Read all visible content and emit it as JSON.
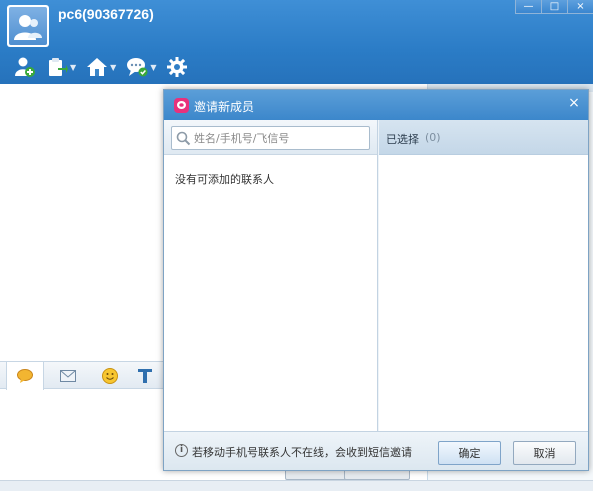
{
  "user": {
    "name": "pc6(90367726)"
  },
  "window_controls": [
    "—",
    "□",
    "×"
  ],
  "toolbar": {
    "items": [
      "add-contact-icon",
      "clipboard-icon",
      "home-icon",
      "chat-status-icon",
      "gear-icon"
    ]
  },
  "dialog": {
    "title": "邀请新成员",
    "close": "×",
    "search_placeholder": "姓名/手机号/飞信号",
    "empty_contacts": "没有可添加的联系人",
    "selected_label": "已选择",
    "selected_count": "(0)",
    "footer_note": "若移动手机号联系人不在线，会收到短信邀请",
    "ok_label": "确定",
    "cancel_label": "取消"
  },
  "colors": {
    "header_blue": "#2b7cc6",
    "dialog_border": "#7ea3c4",
    "logo_pink": "#e8317c"
  }
}
